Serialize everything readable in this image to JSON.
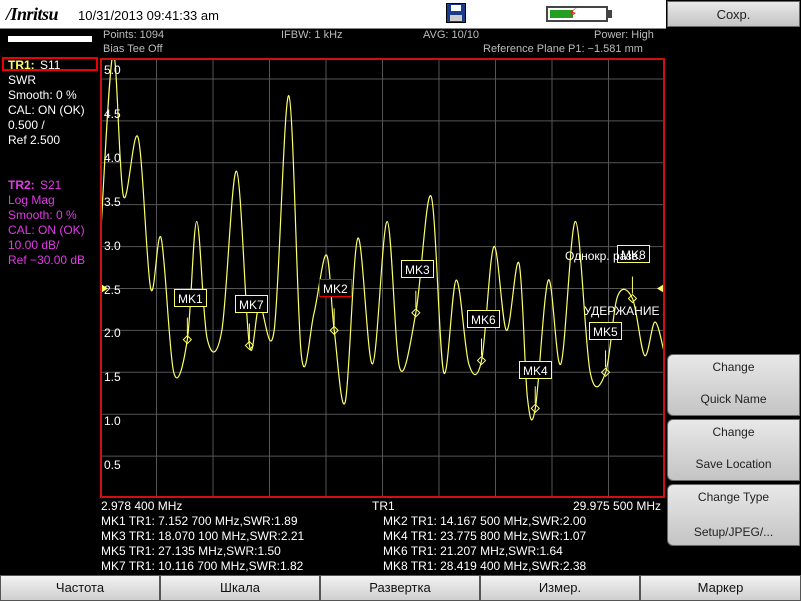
{
  "header": {
    "brand": "/Inritsu",
    "datetime": "10/31/2013 09:41:33 am",
    "icons": {
      "save": "save-disk-icon",
      "battery": "battery-charging-icon"
    },
    "battery_level": 0.4
  },
  "status": {
    "points": "Points: 1094",
    "bias_tee": "Bias Tee Off",
    "ifbw": "IFBW: 1 kHz",
    "avg": "AVG: 10/10",
    "power": "Power: High",
    "ref_plane": "Reference Plane P1: −1.581 mm"
  },
  "traces": {
    "tr1": {
      "title": "TR1:",
      "param": "S11",
      "format": "SWR",
      "smooth": "Smooth: 0 %",
      "cal": "CAL: ON (OK)",
      "scale": "0.500 /",
      "ref": "Ref 2.500",
      "color": "#ffff66"
    },
    "tr2": {
      "title": "TR2:",
      "param": "S21",
      "format": "Log Mag",
      "smooth": "Smooth: 0 %",
      "cal": "CAL: ON (OK)",
      "scale": "10.00 dB/",
      "ref": "Ref −30.00 dB",
      "color": "#e23ae6"
    }
  },
  "plot": {
    "yticks": [
      "5.0",
      "4.5",
      "4.0",
      "3.5",
      "3.0",
      "2.5",
      "2.0",
      "1.5",
      "1.0",
      "0.5"
    ],
    "start_freq": "2.978 400 MHz",
    "center_label": "TR1",
    "stop_freq": "29.975 500 MHz",
    "sweep_label": "Однокр. разв.",
    "hold_label": "УДЕРЖАНИЕ"
  },
  "markers": [
    {
      "id": "MK1",
      "label": "MK1",
      "readout": "MK1 TR1:  7.152 700 MHz,SWR:1.89"
    },
    {
      "id": "MK2",
      "label": "MK2",
      "readout": "MK2 TR1:  14.167 500 MHz,SWR:2.00"
    },
    {
      "id": "MK3",
      "label": "MK3",
      "readout": "MK3 TR1:  18.070 100 MHz,SWR:2.21"
    },
    {
      "id": "MK4",
      "label": "MK4",
      "readout": "MK4 TR1:  23.775 800 MHz,SWR:1.07"
    },
    {
      "id": "MK5",
      "label": "MK5",
      "readout": "MK5 TR1:  27.135 MHz,SWR:1.50"
    },
    {
      "id": "MK6",
      "label": "MK6",
      "readout": "MK6 TR1:  21.207 MHz,SWR:1.64"
    },
    {
      "id": "MK7",
      "label": "MK7",
      "readout": "MK7 TR1:  10.116 700 MHz,SWR:1.82"
    },
    {
      "id": "MK8",
      "label": "MK8",
      "readout": "MK8 TR1:  28.419 400 MHz,SWR:2.38"
    }
  ],
  "right_menu": {
    "title": "Сохр.",
    "buttons": [
      {
        "line1": "Change",
        "line2": "Quick Name"
      },
      {
        "line1": "Change",
        "line2": "Save Location"
      },
      {
        "line1": "Change Type",
        "line2": "Setup/JPEG/..."
      }
    ]
  },
  "bottom_menu": [
    "Частота",
    "Шкала",
    "Развертка",
    "Измер.",
    "Маркер"
  ],
  "chart_data": {
    "type": "line",
    "xlabel": "",
    "ylabel": "",
    "xlim": [
      2.9784,
      29.9755
    ],
    "ylim": [
      0,
      5.25
    ],
    "grid": true,
    "series": [
      {
        "color": "#ffff66",
        "x": [
          2.98,
          3.6,
          4.1,
          4.8,
          5.4,
          5.9,
          6.5,
          7.15,
          7.6,
          8.1,
          8.8,
          9.5,
          10.12,
          10.6,
          11.3,
          12.0,
          12.6,
          13.2,
          13.8,
          14.17,
          14.7,
          15.3,
          16.0,
          16.7,
          17.3,
          18.07,
          18.8,
          19.4,
          20.0,
          20.6,
          21.21,
          21.8,
          22.4,
          23.0,
          23.4,
          23.78,
          24.4,
          25.0,
          25.7,
          26.4,
          27.14,
          27.7,
          28.42,
          29.0,
          29.5,
          29.97
        ],
        "y": [
          3.0,
          5.3,
          3.6,
          4.3,
          2.5,
          3.1,
          1.5,
          1.89,
          3.3,
          1.9,
          2.0,
          3.9,
          1.82,
          2.3,
          2.0,
          4.8,
          1.7,
          2.2,
          2.9,
          2.0,
          1.15,
          3.1,
          1.6,
          3.3,
          1.55,
          2.21,
          3.6,
          1.5,
          2.6,
          1.6,
          1.64,
          3.0,
          2.0,
          2.8,
          1.2,
          1.07,
          2.6,
          1.6,
          3.3,
          1.5,
          1.5,
          2.4,
          2.38,
          1.7,
          2.1,
          1.7
        ]
      }
    ],
    "markers": [
      {
        "label": "MK1",
        "x": 7.1527,
        "y": 1.89
      },
      {
        "label": "MK7",
        "x": 10.1167,
        "y": 1.82
      },
      {
        "label": "MK2",
        "x": 14.1675,
        "y": 2.0
      },
      {
        "label": "MK3",
        "x": 18.0701,
        "y": 2.21
      },
      {
        "label": "MK6",
        "x": 21.207,
        "y": 1.64
      },
      {
        "label": "MK4",
        "x": 23.7758,
        "y": 1.07
      },
      {
        "label": "MK5",
        "x": 27.135,
        "y": 1.5
      },
      {
        "label": "MK8",
        "x": 28.4194,
        "y": 2.38
      }
    ],
    "reference_level": 2.5
  }
}
